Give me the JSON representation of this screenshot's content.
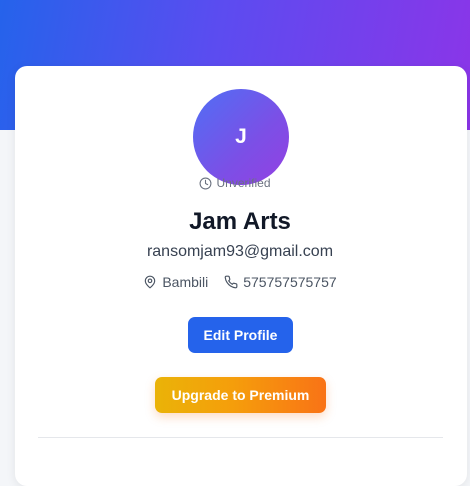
{
  "profile": {
    "avatar_initial": "J",
    "status": "Unverified",
    "name": "Jam Arts",
    "email": "ransomjam93@gmail.com",
    "location": "Bambili",
    "phone": "575757575757"
  },
  "actions": {
    "edit_label": "Edit Profile",
    "upgrade_label": "Upgrade to Premium"
  },
  "icons": {
    "status": "clock-icon",
    "location": "map-pin-icon",
    "phone": "phone-icon"
  },
  "colors": {
    "banner_start": "#2563eb",
    "banner_end": "#8b35e8",
    "primary": "#2563eb",
    "premium_start": "#eab308",
    "premium_end": "#f97316"
  }
}
